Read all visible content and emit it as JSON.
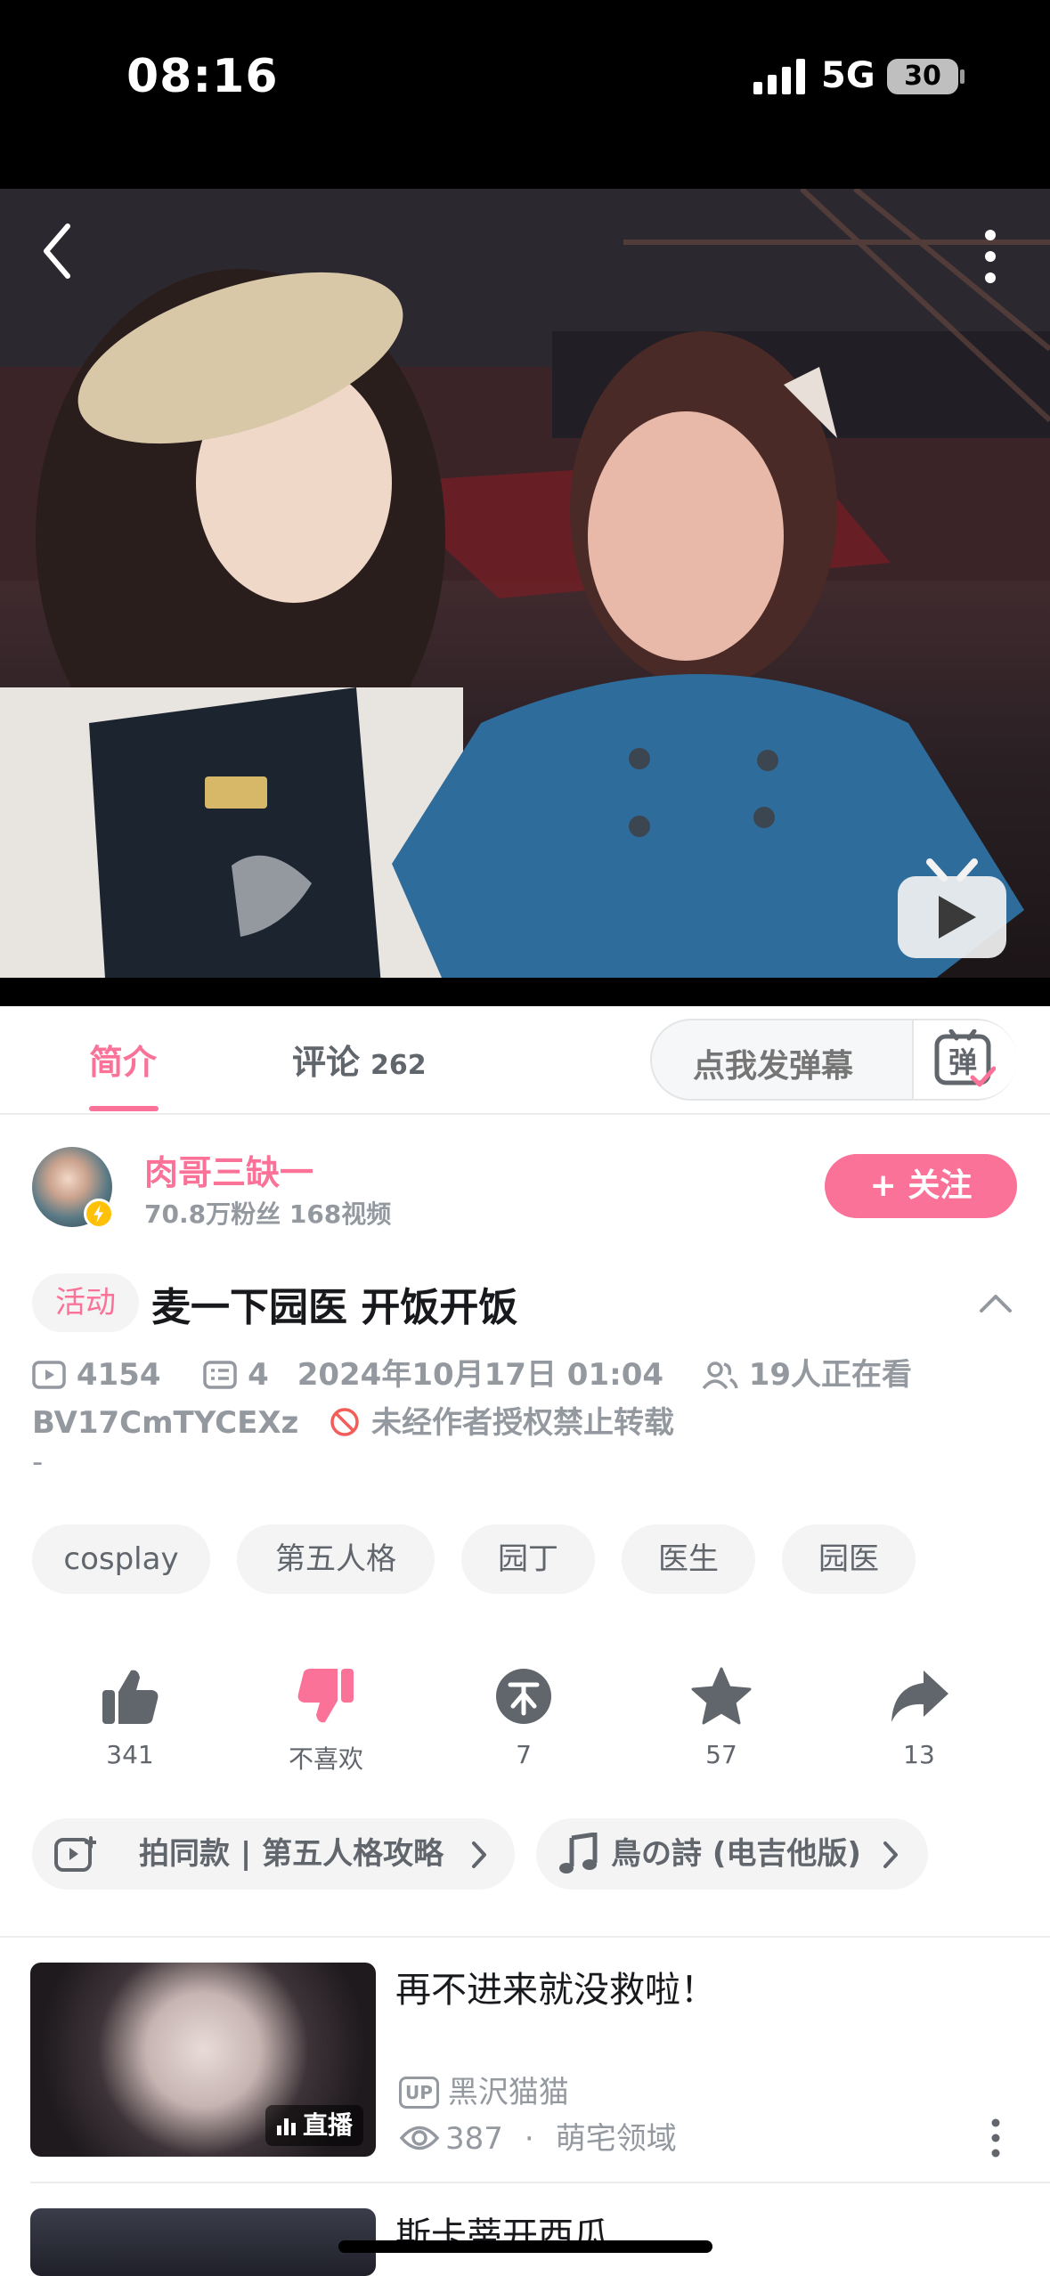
{
  "status_bar": {
    "time": "08:16",
    "network": "5G",
    "battery": "30"
  },
  "tabs": {
    "intro_label": "简介",
    "comments_label": "评论",
    "comments_count": "262",
    "danmaku_placeholder": "点我发弹幕",
    "danmaku_icon_char": "弹"
  },
  "uploader": {
    "name": "肉哥三缺一",
    "stats": "70.8万粉丝  168视频",
    "follow_label": "+ 关注"
  },
  "video": {
    "activity_tag": "活动",
    "title": "麦一下园医 开饭开饭",
    "plays": "4154",
    "danmaku_count": "4",
    "date": "2024年10月17日 01:04",
    "watching": "19人正在看",
    "bvid": "BV17CmTYCEXz",
    "copyright": "未经作者授权禁止转载",
    "description": "-"
  },
  "tags": [
    "cosplay",
    "第五人格",
    "园丁",
    "医生",
    "园医"
  ],
  "actions": {
    "like": "341",
    "dislike": "不喜欢",
    "coin": "7",
    "favorite": "57",
    "share": "13"
  },
  "chips": {
    "same_style": "拍同款 | 第五人格攻略",
    "music": "鳥の詩 (电吉他版)"
  },
  "recommendations": [
    {
      "title": "再不进来就没救啦！",
      "badge": "直播",
      "up_tag": "UP",
      "up_name": "黑沢猫猫",
      "views": "387",
      "separator": "·",
      "category": "萌宅领域"
    },
    {
      "title": "斯卡蒂开西瓜"
    }
  ],
  "colors": {
    "accent": "#fb7299",
    "text_secondary": "#9499a0",
    "chip_bg": "#f4f4f5"
  }
}
